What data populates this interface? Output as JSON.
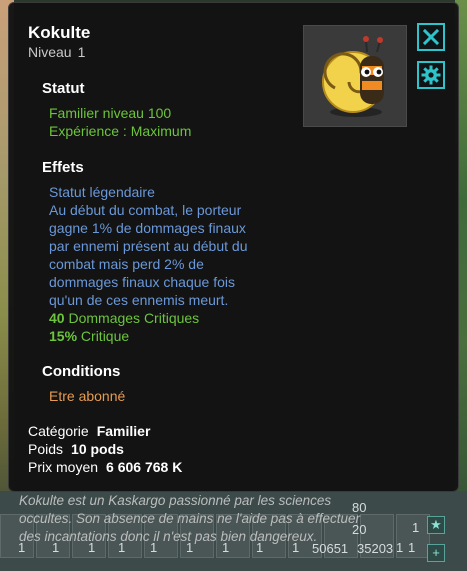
{
  "item": {
    "name": "Kokulte",
    "level_label": "Niveau",
    "level_value": "1"
  },
  "sections": {
    "status_title": "Statut",
    "status_lines": [
      "Familier niveau 100",
      "Expérience : Maximum"
    ],
    "effects_title": "Effets",
    "effects_blue": [
      "Statut légendaire",
      "Au début du combat, le porteur",
      "gagne 1% de dommages finaux",
      "par ennemi présent au début du",
      "combat mais perd 2% de",
      "dommages finaux chaque fois",
      "qu'un de ces ennemis meurt."
    ],
    "effect_stats": [
      {
        "value": "40",
        "label": "Dommages Critiques"
      },
      {
        "value": "15%",
        "label": "Critique"
      }
    ],
    "conditions_title": "Conditions",
    "conditions_line": "Etre abonné"
  },
  "details": {
    "category_label": "Catégorie",
    "category_value": "Familier",
    "weight_label": "Poids",
    "weight_value": "10 pods",
    "price_label": "Prix moyen",
    "price_value": "6 606 768 K"
  },
  "description": [
    "Kokulte est un Kaskargo passionné par les sciences",
    "occultes. Son absence de mains ne l'aide pas à effectuer",
    "des incantations donc il n'est pas bien dangereux."
  ],
  "controls": {
    "close_icon": "close-icon",
    "settings_icon": "gear-icon"
  },
  "background_hud": {
    "slot_counts": [
      "1",
      "1",
      "1",
      "1",
      "1",
      "1",
      "1",
      "1",
      "1",
      "1",
      "1",
      "1"
    ],
    "numbers": [
      "50651",
      "35203"
    ],
    "top_partial_numbers": [
      "80",
      "20"
    ]
  },
  "colors": {
    "accent": "#2ec4c9",
    "status_green": "#6dc43d",
    "effect_blue": "#6b98d9",
    "condition_orange": "#e59b52"
  }
}
